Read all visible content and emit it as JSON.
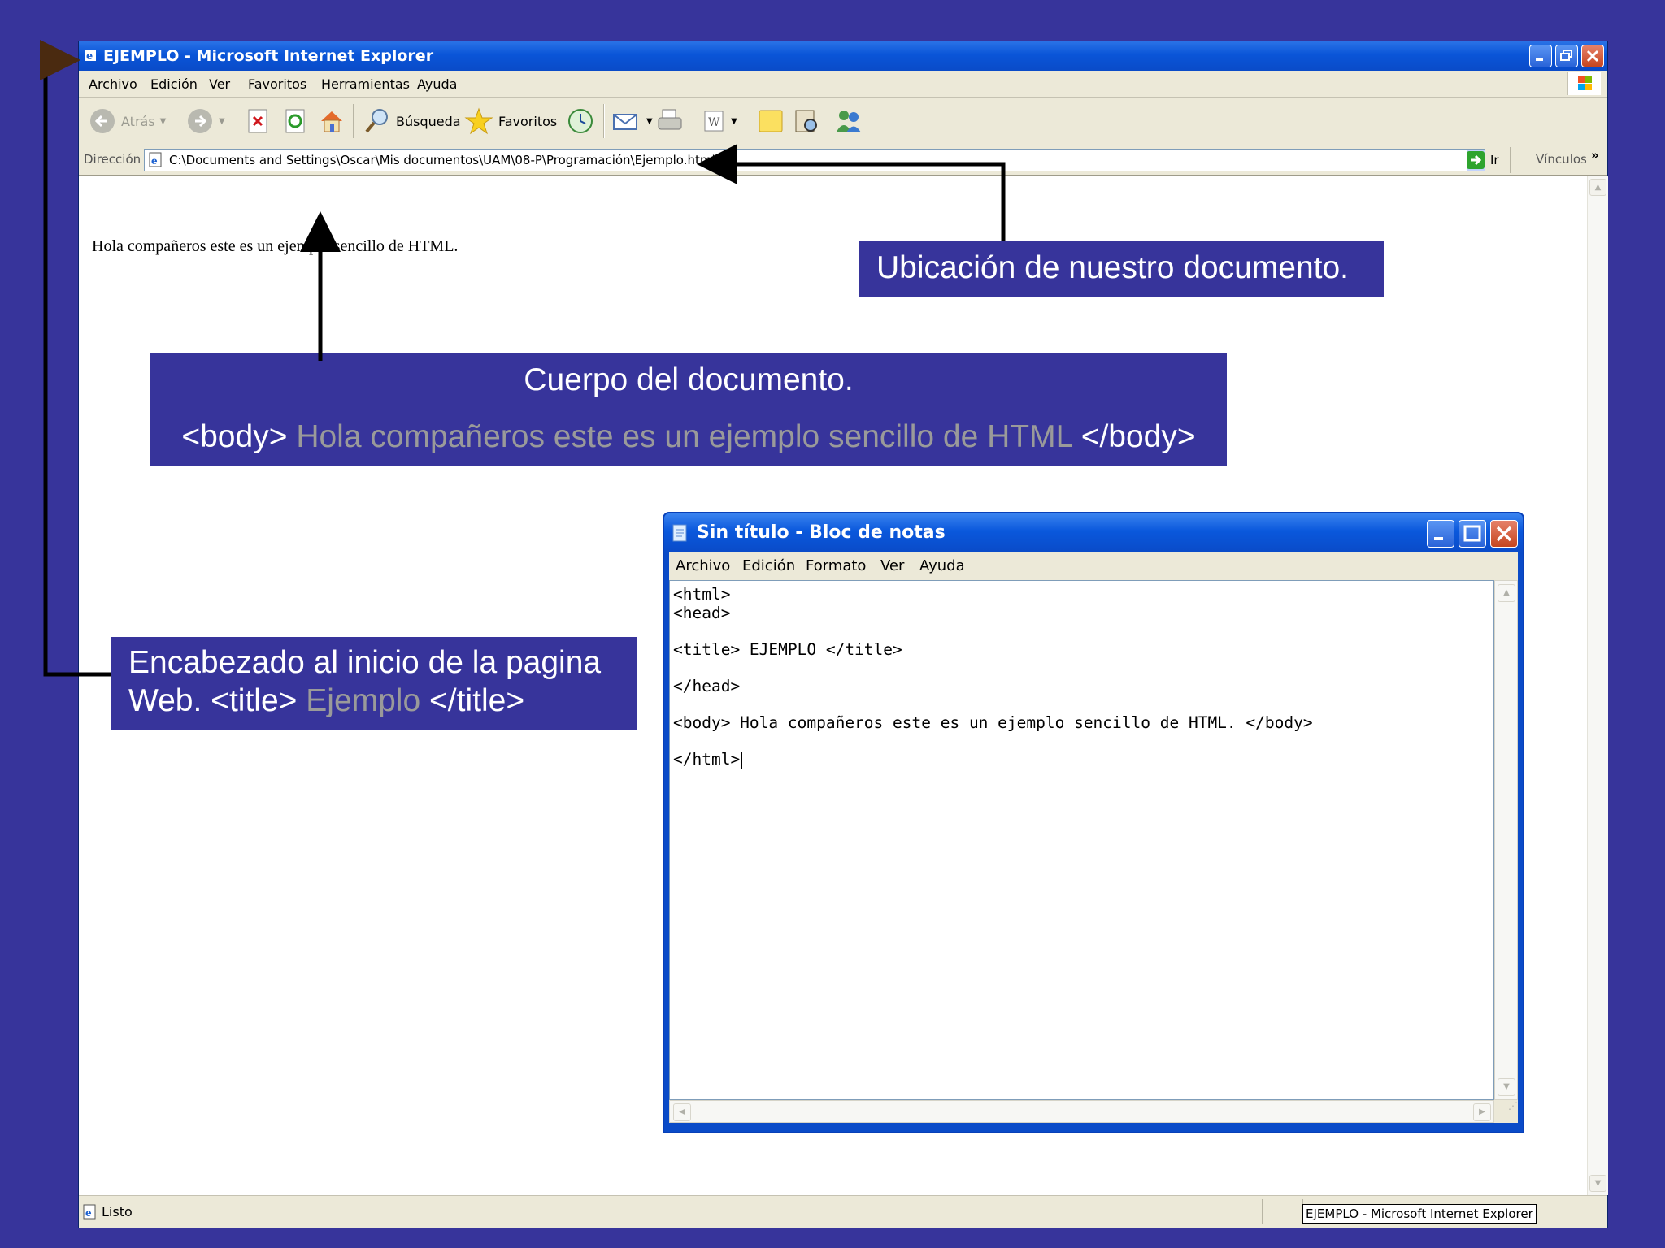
{
  "ie": {
    "title": "EJEMPLO - Microsoft Internet Explorer",
    "menu": [
      "Archivo",
      "Edición",
      "Ver",
      "Favoritos",
      "Herramientas",
      "Ayuda"
    ],
    "toolbar": {
      "back": "Atrás",
      "search": "Búsqueda",
      "favorites": "Favoritos"
    },
    "address": {
      "label": "Dirección",
      "value": "C:\\Documents and Settings\\Oscar\\Mis documentos\\UAM\\08-P\\Programación\\Ejemplo.html",
      "go": "Ir",
      "links": "Vínculos"
    },
    "content_text": "Hola compañeros este es un ejemplo sencillo de HTML.",
    "status": {
      "text": "Listo",
      "taskbar_item": "EJEMPLO - Microsoft Internet Explorer"
    }
  },
  "notepad": {
    "title": "Sin título - Bloc de notas",
    "menu": [
      "Archivo",
      "Edición",
      "Formato",
      "Ver",
      "Ayuda"
    ],
    "lines": [
      "<html>",
      "<head>",
      "",
      "<title> EJEMPLO </title>",
      "",
      "</head>",
      "",
      "<body> Hola compañeros este es un ejemplo sencillo de HTML. </body>",
      "",
      "</html>"
    ]
  },
  "callouts": {
    "location": "Ubicación de nuestro documento.",
    "body_heading": "Cuerpo del documento.",
    "body_open": "<body>",
    "body_example": "Hola compañeros este es un ejemplo sencillo de HTML",
    "body_close": "</body>",
    "header_line1": "Encabezado al inicio de la pagina",
    "header_web": "Web.",
    "header_title_open": "<title>",
    "header_example": "Ejemplo",
    "header_title_close": "</title>"
  },
  "colors": {
    "slide_background": "#37349b",
    "xp_title_blue": "#0a55d8",
    "xp_face": "#ece9d8",
    "highlight_gray": "#9a9a9a"
  }
}
